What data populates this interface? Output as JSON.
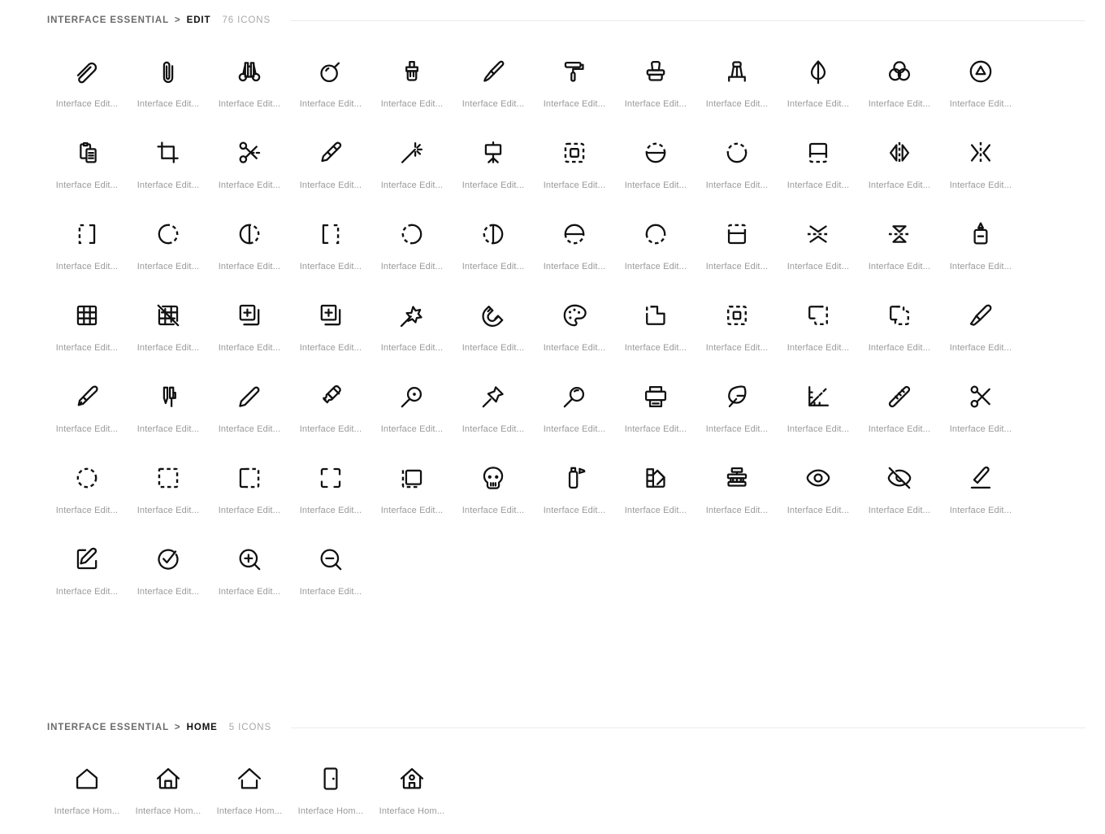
{
  "sections": [
    {
      "id": "edit",
      "breadcrumb_root": "INTERFACE ESSENTIAL",
      "breadcrumb_sep": ">",
      "breadcrumb_leaf": "EDIT",
      "count_label": "76 ICONS",
      "count": 76,
      "caption": "Interface Edit...",
      "icons": [
        {
          "name": "paperclip-angled-icon",
          "caption": "Interface Edit..."
        },
        {
          "name": "paperclip-icon",
          "caption": "Interface Edit..."
        },
        {
          "name": "binoculars-icon",
          "caption": "Interface Edit..."
        },
        {
          "name": "bomb-icon",
          "caption": "Interface Edit..."
        },
        {
          "name": "paint-brush-wide-icon",
          "caption": "Interface Edit..."
        },
        {
          "name": "paintbrush-icon",
          "caption": "Interface Edit..."
        },
        {
          "name": "paint-roller-icon",
          "caption": "Interface Edit..."
        },
        {
          "name": "stamp-icon",
          "caption": "Interface Edit..."
        },
        {
          "name": "clamp-icon",
          "caption": "Interface Edit..."
        },
        {
          "name": "droplet-half-icon",
          "caption": "Interface Edit..."
        },
        {
          "name": "color-mix-circles-icon",
          "caption": "Interface Edit..."
        },
        {
          "name": "circle-triangle-icon",
          "caption": "Interface Edit..."
        },
        {
          "name": "copy-paste-icon",
          "caption": "Interface Edit..."
        },
        {
          "name": "crop-icon",
          "caption": "Interface Edit..."
        },
        {
          "name": "scissors-cut-icon",
          "caption": "Interface Edit..."
        },
        {
          "name": "highlighter-icon",
          "caption": "Interface Edit..."
        },
        {
          "name": "magic-wand-sparkle-icon",
          "caption": "Interface Edit..."
        },
        {
          "name": "easel-icon",
          "caption": "Interface Edit..."
        },
        {
          "name": "select-square-dashed-icon",
          "caption": "Interface Edit..."
        },
        {
          "name": "flip-circle-horizontal-icon",
          "caption": "Interface Edit..."
        },
        {
          "name": "circle-dashed-top-icon",
          "caption": "Interface Edit..."
        },
        {
          "name": "rect-half-dashed-bottom-icon",
          "caption": "Interface Edit..."
        },
        {
          "name": "flip-horizontal-arrows-icon",
          "caption": "Interface Edit..."
        },
        {
          "name": "merge-horizontal-icon",
          "caption": "Interface Edit..."
        },
        {
          "name": "brackets-mirror-left-icon",
          "caption": "Interface Edit..."
        },
        {
          "name": "circle-dashed-right-icon",
          "caption": "Interface Edit..."
        },
        {
          "name": "circle-half-dashed-right-icon",
          "caption": "Interface Edit..."
        },
        {
          "name": "brackets-mirror-right-icon",
          "caption": "Interface Edit..."
        },
        {
          "name": "circle-dashed-left-icon",
          "caption": "Interface Edit..."
        },
        {
          "name": "circle-half-dashed-left-icon",
          "caption": "Interface Edit..."
        },
        {
          "name": "circle-half-dashed-bottom-icon",
          "caption": "Interface Edit..."
        },
        {
          "name": "circle-dashed-bottom-icon",
          "caption": "Interface Edit..."
        },
        {
          "name": "rect-half-dashed-top-icon",
          "caption": "Interface Edit..."
        },
        {
          "name": "flip-vertical-arrows-icon",
          "caption": "Interface Edit..."
        },
        {
          "name": "flip-vertical-triangles-icon",
          "caption": "Interface Edit..."
        },
        {
          "name": "ink-bottle-icon",
          "caption": "Interface Edit..."
        },
        {
          "name": "grid-icon",
          "caption": "Interface Edit..."
        },
        {
          "name": "grid-off-icon",
          "caption": "Interface Edit..."
        },
        {
          "name": "add-layer-round-icon",
          "caption": "Interface Edit..."
        },
        {
          "name": "add-layer-square-icon",
          "caption": "Interface Edit..."
        },
        {
          "name": "magic-wand-star-icon",
          "caption": "Interface Edit..."
        },
        {
          "name": "magnet-icon",
          "caption": "Interface Edit..."
        },
        {
          "name": "palette-icon",
          "caption": "Interface Edit..."
        },
        {
          "name": "boolean-subtract-icon",
          "caption": "Interface Edit..."
        },
        {
          "name": "boolean-intersect-icon",
          "caption": "Interface Edit..."
        },
        {
          "name": "boolean-exclude-icon",
          "caption": "Interface Edit..."
        },
        {
          "name": "boolean-union-icon",
          "caption": "Interface Edit..."
        },
        {
          "name": "pen-write-icon",
          "caption": "Interface Edit..."
        },
        {
          "name": "pen-nib-icon",
          "caption": "Interface Edit..."
        },
        {
          "name": "two-pens-icon",
          "caption": "Interface Edit..."
        },
        {
          "name": "pencil-icon",
          "caption": "Interface Edit..."
        },
        {
          "name": "marker-icon",
          "caption": "Interface Edit..."
        },
        {
          "name": "loupe-icon",
          "caption": "Interface Edit..."
        },
        {
          "name": "push-pin-icon",
          "caption": "Interface Edit..."
        },
        {
          "name": "magnifier-icon",
          "caption": "Interface Edit..."
        },
        {
          "name": "printer-icon",
          "caption": "Interface Edit..."
        },
        {
          "name": "feather-quill-icon",
          "caption": "Interface Edit..."
        },
        {
          "name": "ruler-angle-icon",
          "caption": "Interface Edit..."
        },
        {
          "name": "ruler-icon",
          "caption": "Interface Edit..."
        },
        {
          "name": "scissors-icon",
          "caption": "Interface Edit..."
        },
        {
          "name": "selection-circle-dashed-icon",
          "caption": "Interface Edit..."
        },
        {
          "name": "selection-square-dashed-icon",
          "caption": "Interface Edit..."
        },
        {
          "name": "selection-partial-dashed-icon",
          "caption": "Interface Edit..."
        },
        {
          "name": "selection-corners-icon",
          "caption": "Interface Edit..."
        },
        {
          "name": "selection-shape-icon",
          "caption": "Interface Edit..."
        },
        {
          "name": "skull-icon",
          "caption": "Interface Edit..."
        },
        {
          "name": "spray-can-icon",
          "caption": "Interface Edit..."
        },
        {
          "name": "color-swatches-icon",
          "caption": "Interface Edit..."
        },
        {
          "name": "press-stamp-icon",
          "caption": "Interface Edit..."
        },
        {
          "name": "eye-icon",
          "caption": "Interface Edit..."
        },
        {
          "name": "eye-off-icon",
          "caption": "Interface Edit..."
        },
        {
          "name": "pen-underline-icon",
          "caption": "Interface Edit..."
        },
        {
          "name": "edit-square-pencil-icon",
          "caption": "Interface Edit..."
        },
        {
          "name": "circle-check-stroke-icon",
          "caption": "Interface Edit..."
        },
        {
          "name": "zoom-in-icon",
          "caption": "Interface Edit..."
        },
        {
          "name": "zoom-out-icon",
          "caption": "Interface Edit..."
        }
      ]
    },
    {
      "id": "home",
      "breadcrumb_root": "INTERFACE ESSENTIAL",
      "breadcrumb_sep": ">",
      "breadcrumb_leaf": "HOME",
      "count_label": "5 ICONS",
      "count": 5,
      "caption": "Interface Hom...",
      "icons": [
        {
          "name": "home-outline-icon",
          "caption": "Interface Hom..."
        },
        {
          "name": "home-door-icon",
          "caption": "Interface Hom..."
        },
        {
          "name": "home-open-icon",
          "caption": "Interface Hom..."
        },
        {
          "name": "door-icon",
          "caption": "Interface Hom..."
        },
        {
          "name": "home-window-icon",
          "caption": "Interface Hom..."
        }
      ]
    }
  ],
  "colors": {
    "icon_stroke": "#111111",
    "caption_text": "#9a9a9a",
    "crumb_root": "#6b6b6b",
    "crumb_leaf": "#111111",
    "count_text": "#a8a8a8",
    "rule": "#ebebeb",
    "background": "#ffffff"
  }
}
